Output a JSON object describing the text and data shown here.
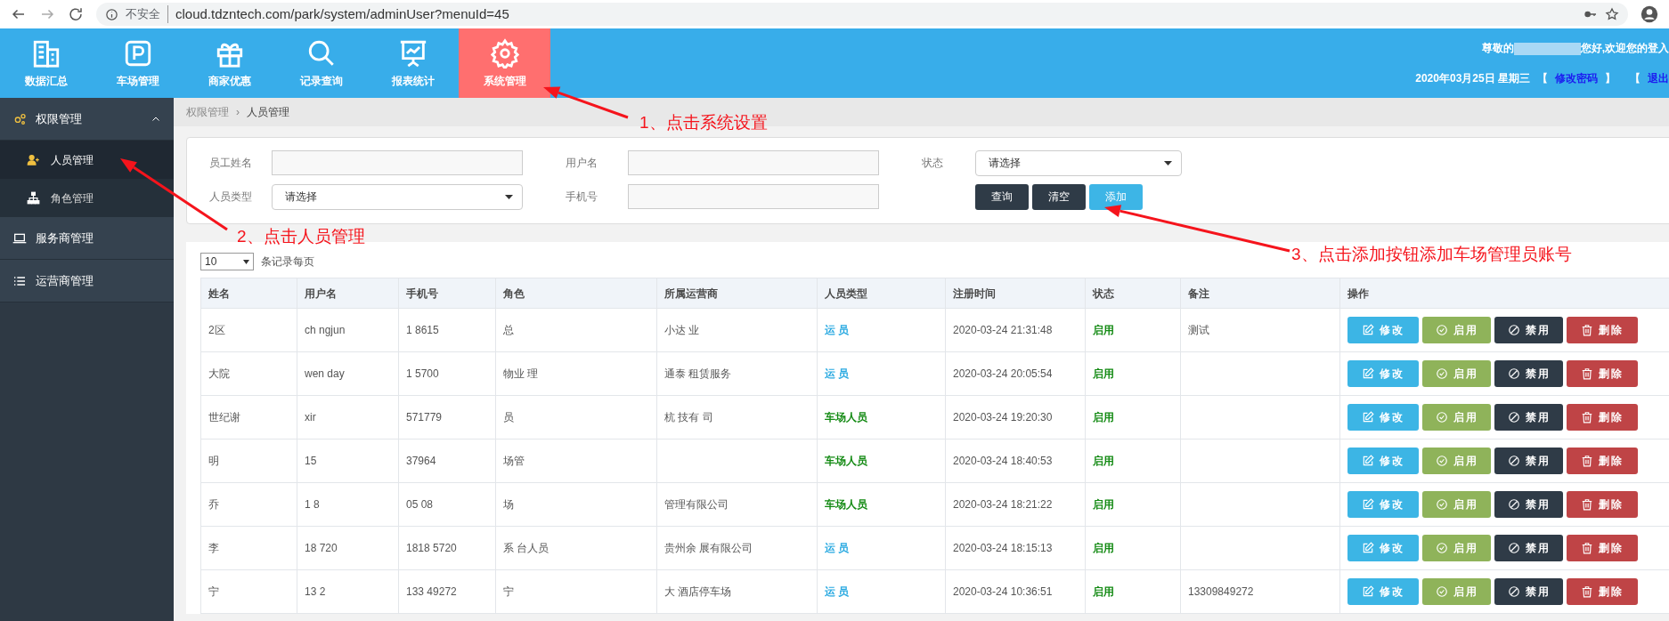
{
  "browser": {
    "security": "不安全",
    "url": "cloud.tdzntech.com/park/system/adminUser?menuId=45"
  },
  "nav": [
    {
      "label": "数据汇总",
      "selected": false
    },
    {
      "label": "车场管理",
      "selected": false
    },
    {
      "label": "商家优惠",
      "selected": false
    },
    {
      "label": "记录查询",
      "selected": false
    },
    {
      "label": "报表统计",
      "selected": false
    },
    {
      "label": "系统管理",
      "selected": true
    }
  ],
  "header_right": {
    "greeting_start": "尊敬的",
    "greeting_end": "您好,欢迎您的登入",
    "date": "2020年03月25日 星期三",
    "bracket_open": "【",
    "change_password": "修改密码",
    "bracket_close": "】",
    "bracket_open_2": "【",
    "logout": "退出"
  },
  "sidebar": [
    {
      "label": "权限管理",
      "expanded": true,
      "children": [
        {
          "label": "人员管理",
          "selected": true
        },
        {
          "label": "角色管理",
          "selected": false
        }
      ]
    },
    {
      "label": "服务商管理",
      "expanded": false
    },
    {
      "label": "运营商管理",
      "expanded": false
    }
  ],
  "breadcrumb": {
    "items": [
      "权限管理",
      "人员管理"
    ],
    "separator": "›"
  },
  "filters": {
    "name_label": "员工姓名",
    "username_label": "用户名",
    "status_label": "状态",
    "status_value": "请选择",
    "type_label": "人员类型",
    "type_value": "请选择",
    "phone_label": "手机号"
  },
  "filter_buttons": [
    {
      "label": "查询",
      "kind": "dark"
    },
    {
      "label": "清空",
      "kind": "dark"
    },
    {
      "label": "添加",
      "kind": "info"
    }
  ],
  "page_size": {
    "value": "10",
    "label": "条记录每页"
  },
  "table": {
    "columns": [
      "姓名",
      "用户名",
      "手机号",
      "角色",
      "所属运营商",
      "人员类型",
      "注册时间",
      "状态",
      "备注",
      "操作"
    ],
    "rows": [
      {
        "cells": [
          "2区",
          "ch ngjun",
          "1 8615",
          "总",
          "小达 业"
        ],
        "type": {
          "text": "运 员",
          "color": "#29a9e1"
        },
        "time": "2020-03-24 21:31:48",
        "status": "启用",
        "note": "测试",
        "actions": [
          {
            "label": "修改",
            "kind": "edit"
          },
          {
            "label": "启用",
            "kind": "enable"
          },
          {
            "label": "禁用",
            "kind": "disable"
          },
          {
            "label": "删除",
            "kind": "delete"
          }
        ]
      },
      {
        "cells": [
          "大院",
          "wen day",
          "1 5700",
          "物业 理",
          "通泰 租赁服务"
        ],
        "type": {
          "text": "运 员",
          "color": "#29a9e1"
        },
        "time": "2020-03-24 20:05:54",
        "status": "启用",
        "actions": [
          {
            "label": "修改",
            "kind": "edit"
          },
          {
            "label": "启用",
            "kind": "enable"
          },
          {
            "label": "禁用",
            "kind": "disable"
          },
          {
            "label": "删除",
            "kind": "delete"
          }
        ]
      },
      {
        "cells": [
          "世纪谢",
          "xir",
          "571779",
          "员",
          "杭 技有 司"
        ],
        "type": {
          "text": "车场人员",
          "color": "#138a13"
        },
        "time": "2020-03-24 19:20:30",
        "status": "启用",
        "actions": [
          {
            "label": "修改",
            "kind": "edit"
          },
          {
            "label": "启用",
            "kind": "enable"
          },
          {
            "label": "禁用",
            "kind": "disable"
          },
          {
            "label": "删除",
            "kind": "delete"
          }
        ]
      },
      {
        "cells": [
          "明",
          "15",
          "37964",
          "场管",
          ""
        ],
        "type": {
          "text": "车场人员",
          "color": "#138a13"
        },
        "time": "2020-03-24 18:40:53",
        "status": "启用",
        "actions": [
          {
            "label": "修改",
            "kind": "edit"
          },
          {
            "label": "启用",
            "kind": "enable"
          },
          {
            "label": "禁用",
            "kind": "disable"
          },
          {
            "label": "删除",
            "kind": "delete"
          }
        ]
      },
      {
        "cells": [
          "乔",
          "1 8",
          "05 08",
          "场",
          "管理有限公司"
        ],
        "type": {
          "text": "车场人员",
          "color": "#138a13"
        },
        "time": "2020-03-24 18:21:22",
        "status": "启用",
        "actions": [
          {
            "label": "修改",
            "kind": "edit"
          },
          {
            "label": "启用",
            "kind": "enable"
          },
          {
            "label": "禁用",
            "kind": "disable"
          },
          {
            "label": "删除",
            "kind": "delete"
          }
        ]
      },
      {
        "cells": [
          "李",
          "18 720",
          "1818 5720",
          "系 台人员",
          "贵州余 展有限公司"
        ],
        "type": {
          "text": "运 员",
          "color": "#29a9e1"
        },
        "time": "2020-03-24 18:15:13",
        "status": "启用",
        "actions": [
          {
            "label": "修改",
            "kind": "edit"
          },
          {
            "label": "启用",
            "kind": "enable"
          },
          {
            "label": "禁用",
            "kind": "disable"
          },
          {
            "label": "删除",
            "kind": "delete"
          }
        ]
      },
      {
        "cells": [
          "宁",
          "13 2",
          "133 49272",
          "宁",
          "大 酒店停车场"
        ],
        "type": {
          "text": "运 员",
          "color": "#29a9e1"
        },
        "time": "2020-03-24 10:36:51",
        "status": "启用",
        "note": "13309849272",
        "actions": [
          {
            "label": "修改",
            "kind": "edit"
          },
          {
            "label": "启用",
            "kind": "enable"
          },
          {
            "label": "禁用",
            "kind": "disable"
          },
          {
            "label": "删除",
            "kind": "delete"
          }
        ]
      }
    ]
  },
  "annotations": [
    {
      "text": "1、点击系统设置"
    },
    {
      "text": "2、点击人员管理"
    },
    {
      "text": "3、点击添加按钮添加车场管理员账号"
    }
  ]
}
